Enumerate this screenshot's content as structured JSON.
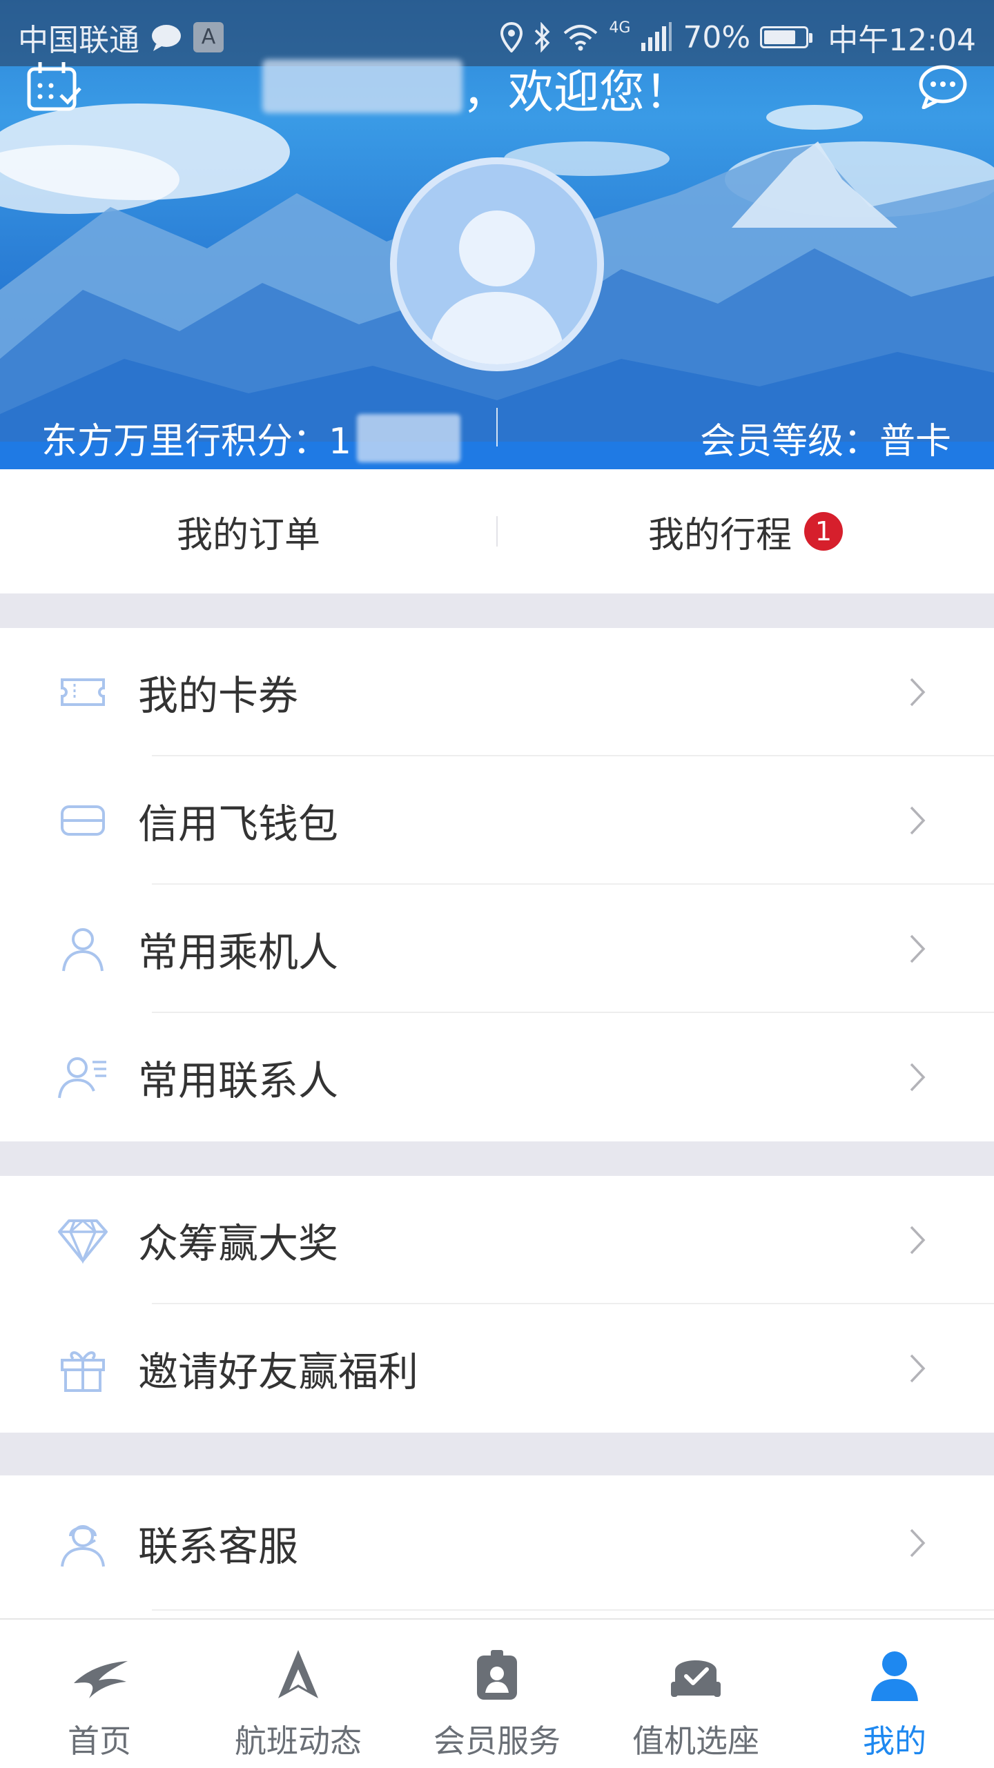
{
  "status_bar": {
    "carrier": "中国联通",
    "input_badge": "A",
    "network": "4G",
    "battery": "70%",
    "time": "中午12:04"
  },
  "header": {
    "welcome": "，欢迎您！",
    "points_label": "东方万里行积分：1",
    "member_level": "会员等级：普卡"
  },
  "tabs": {
    "orders": "我的订单",
    "trips": "我的行程",
    "trips_badge": "1"
  },
  "menu_groups": [
    {
      "items": [
        {
          "label": "我的卡券",
          "icon": "ticket-icon"
        },
        {
          "label": "信用飞钱包",
          "icon": "wallet-card-icon"
        },
        {
          "label": "常用乘机人",
          "icon": "person-icon"
        },
        {
          "label": "常用联系人",
          "icon": "contact-list-icon"
        }
      ]
    },
    {
      "items": [
        {
          "label": "众筹赢大奖",
          "icon": "diamond-icon"
        },
        {
          "label": "邀请好友赢福利",
          "icon": "gift-icon"
        }
      ]
    },
    {
      "items": [
        {
          "label": "联系客服",
          "icon": "headset-person-icon"
        }
      ]
    }
  ],
  "bottom_nav": [
    {
      "label": "首页",
      "icon": "swallow-logo-icon",
      "active": false
    },
    {
      "label": "航班动态",
      "icon": "plane-arrow-icon",
      "active": false
    },
    {
      "label": "会员服务",
      "icon": "member-card-icon",
      "active": false
    },
    {
      "label": "值机选座",
      "icon": "seat-check-icon",
      "active": false
    },
    {
      "label": "我的",
      "icon": "profile-icon",
      "active": true
    }
  ],
  "colors": {
    "accent": "#1e88f0",
    "icon_tint": "#a9c4ee",
    "badge": "#d61f2c",
    "divider_gap": "#e7e7ee"
  }
}
